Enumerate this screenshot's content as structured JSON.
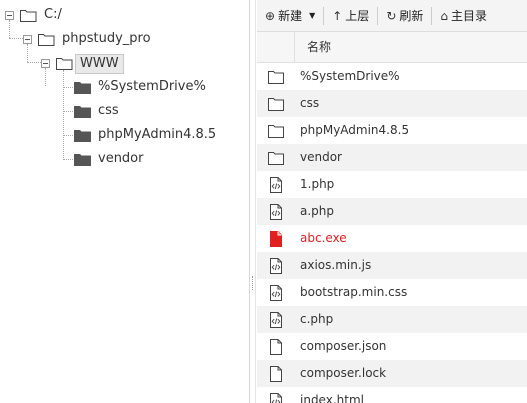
{
  "tree": {
    "root": "C:/",
    "phpstudy": "phpstudy_pro",
    "www": "WWW",
    "children": [
      "%SystemDrive%",
      "css",
      "phpMyAdmin4.8.5",
      "vendor"
    ]
  },
  "toolbar": {
    "new_label": "新建",
    "up_label": "上层",
    "refresh_label": "刷新",
    "home_label": "主目录"
  },
  "header": {
    "name_label": "名称"
  },
  "files": [
    {
      "name": "%SystemDrive%",
      "type": "folder"
    },
    {
      "name": "css",
      "type": "folder"
    },
    {
      "name": "phpMyAdmin4.8.5",
      "type": "folder"
    },
    {
      "name": "vendor",
      "type": "folder"
    },
    {
      "name": "1.php",
      "type": "code"
    },
    {
      "name": "a.php",
      "type": "code"
    },
    {
      "name": "abc.exe",
      "type": "exe"
    },
    {
      "name": "axios.min.js",
      "type": "code"
    },
    {
      "name": "bootstrap.min.css",
      "type": "code"
    },
    {
      "name": "c.php",
      "type": "code"
    },
    {
      "name": "composer.json",
      "type": "file"
    },
    {
      "name": "composer.lock",
      "type": "file"
    },
    {
      "name": "index.html",
      "type": "code"
    }
  ],
  "colors": {
    "exe": "#e02020",
    "folder_fill": "#555555",
    "toolbar_bg": "#f4f4f4"
  }
}
